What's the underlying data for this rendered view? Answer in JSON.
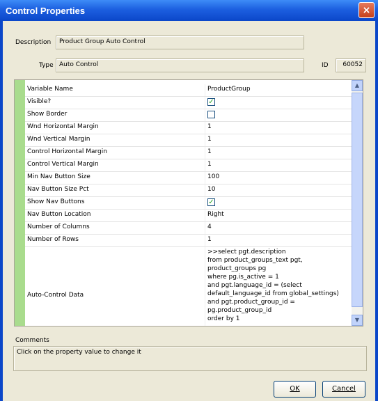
{
  "window": {
    "title": "Control Properties",
    "close_glyph": "×"
  },
  "header": {
    "description_label": "Description",
    "description_value": "Product Group Auto Control",
    "type_label": "Type",
    "type_value": "Auto Control",
    "id_label": "ID",
    "id_value": "60052"
  },
  "grid": {
    "rows": [
      {
        "name": "Variable Name",
        "value": "ProductGroup"
      },
      {
        "name": "Visible?",
        "checked": true
      },
      {
        "name": "Show Border",
        "checked": false
      },
      {
        "name": "Wnd Horizontal Margin",
        "value": "1"
      },
      {
        "name": "Wnd Vertical Margin",
        "value": "1"
      },
      {
        "name": "Control Horizontal Margin",
        "value": "1"
      },
      {
        "name": "Control  Vertical Margin",
        "value": "1"
      },
      {
        "name": "Min Nav Button Size",
        "value": "100"
      },
      {
        "name": "Nav Button Size Pct",
        "value": "10"
      },
      {
        "name": "Show Nav Buttons",
        "checked": true
      },
      {
        "name": "Nav Button Location",
        "value": "Right"
      },
      {
        "name": "Number of Columns",
        "value": "4"
      },
      {
        "name": "Number of Rows",
        "value": "1"
      }
    ],
    "auto_control": {
      "name": "Auto-Control Data",
      "lines": [
        ">>select pgt.description",
        "from product_groups_text pgt,",
        "product_groups pg",
        "where pg.is_active = 1",
        "and pgt.language_id = (select",
        "default_language_id from global_settings)",
        "and pgt.product_group_id =",
        "pg.product_group_id",
        "order by 1"
      ]
    },
    "check_glyph": "✓"
  },
  "scrollbar": {
    "up_glyph": "▲",
    "down_glyph": "▼"
  },
  "comments": {
    "label": "Comments",
    "text": "Click on the property value to change it"
  },
  "buttons": {
    "ok": "OK",
    "cancel": "Cancel"
  }
}
